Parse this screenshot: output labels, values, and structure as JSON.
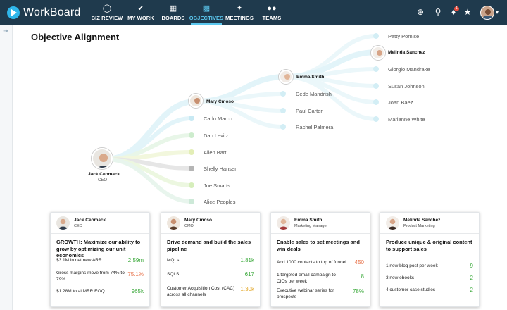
{
  "app": {
    "name": "WorkBoard"
  },
  "nav": [
    {
      "label": "BIZ REVIEW",
      "icon": "gauge-icon"
    },
    {
      "label": "MY WORK",
      "icon": "check-icon"
    },
    {
      "label": "BOARDS",
      "icon": "boards-icon"
    },
    {
      "label": "OBJECTIVES",
      "icon": "bar-chart-icon",
      "active": true
    },
    {
      "label": "MEETINGS",
      "icon": "meetings-icon"
    },
    {
      "label": "TEAMS",
      "icon": "teams-icon"
    }
  ],
  "notifications": {
    "count": "1"
  },
  "page": {
    "title": "Objective Alignment"
  },
  "tree": {
    "root": {
      "name": "Jack Ceomack",
      "role": "CEO"
    },
    "level1": {
      "name": "Mary Cmoso",
      "peers": [
        "Carlo Marco",
        "Dan Levitz",
        "Allen Bart",
        "Shelly Hansen",
        "Joe Smarts",
        "Alice Peoples"
      ]
    },
    "level2": {
      "name": "Emma Smith",
      "peers": [
        "Dede Mandrish",
        "Paul Carter",
        "Rachel Palmera"
      ]
    },
    "level3": {
      "name": "Melinda Sanchez",
      "peers": [
        "Patty Pomise",
        "Giorgio Mandrake",
        "Susan Johnson",
        "Joan Baez",
        "Marianne White"
      ]
    }
  },
  "cards": [
    {
      "name": "Jack Ceomack",
      "role": "CEO",
      "objective": "GROWTH: Maximize our ability to grow by optimizing our unit economics",
      "krs": [
        {
          "text": "$3.1M in net new ARR",
          "value": "2.59m",
          "status": "g"
        },
        {
          "text": "Gross margins move from 74% to 79%",
          "value": "75.1%",
          "status": "o"
        },
        {
          "text": "$1.28M total MRR EOQ",
          "value": "965k",
          "status": "g"
        }
      ]
    },
    {
      "name": "Mary Cmoso",
      "role": "CMO",
      "objective": "Drive demand and build the sales pipeline",
      "krs": [
        {
          "text": "MQLs",
          "value": "1.81k",
          "status": "g"
        },
        {
          "text": "SQLS",
          "value": "617",
          "status": "g"
        },
        {
          "text": "Customer Acquisition Cost (CAC) across all channels",
          "value": "1.30k",
          "status": "y"
        }
      ]
    },
    {
      "name": "Emma Smith",
      "role": "Marketing Manager",
      "objective": "Enable sales to set meetings and win deals",
      "krs": [
        {
          "text": "Add 1000 contacts to top of funnel",
          "value": "450",
          "status": "o"
        },
        {
          "text": "1 targeted email campaign to CIOs per week",
          "value": "8",
          "status": "g"
        },
        {
          "text": "Executive webinar series for prospects",
          "value": "78%",
          "status": "g"
        }
      ]
    },
    {
      "name": "Melinda Sanchez",
      "role": "Product Marketing",
      "objective": "Produce unique & original content to support sales",
      "krs": [
        {
          "text": "1 new blog post per week",
          "value": "9",
          "status": "g"
        },
        {
          "text": "3 new ebooks",
          "value": "2",
          "status": "g"
        },
        {
          "text": "4 customer case studies",
          "value": "2",
          "status": "g"
        }
      ]
    }
  ]
}
